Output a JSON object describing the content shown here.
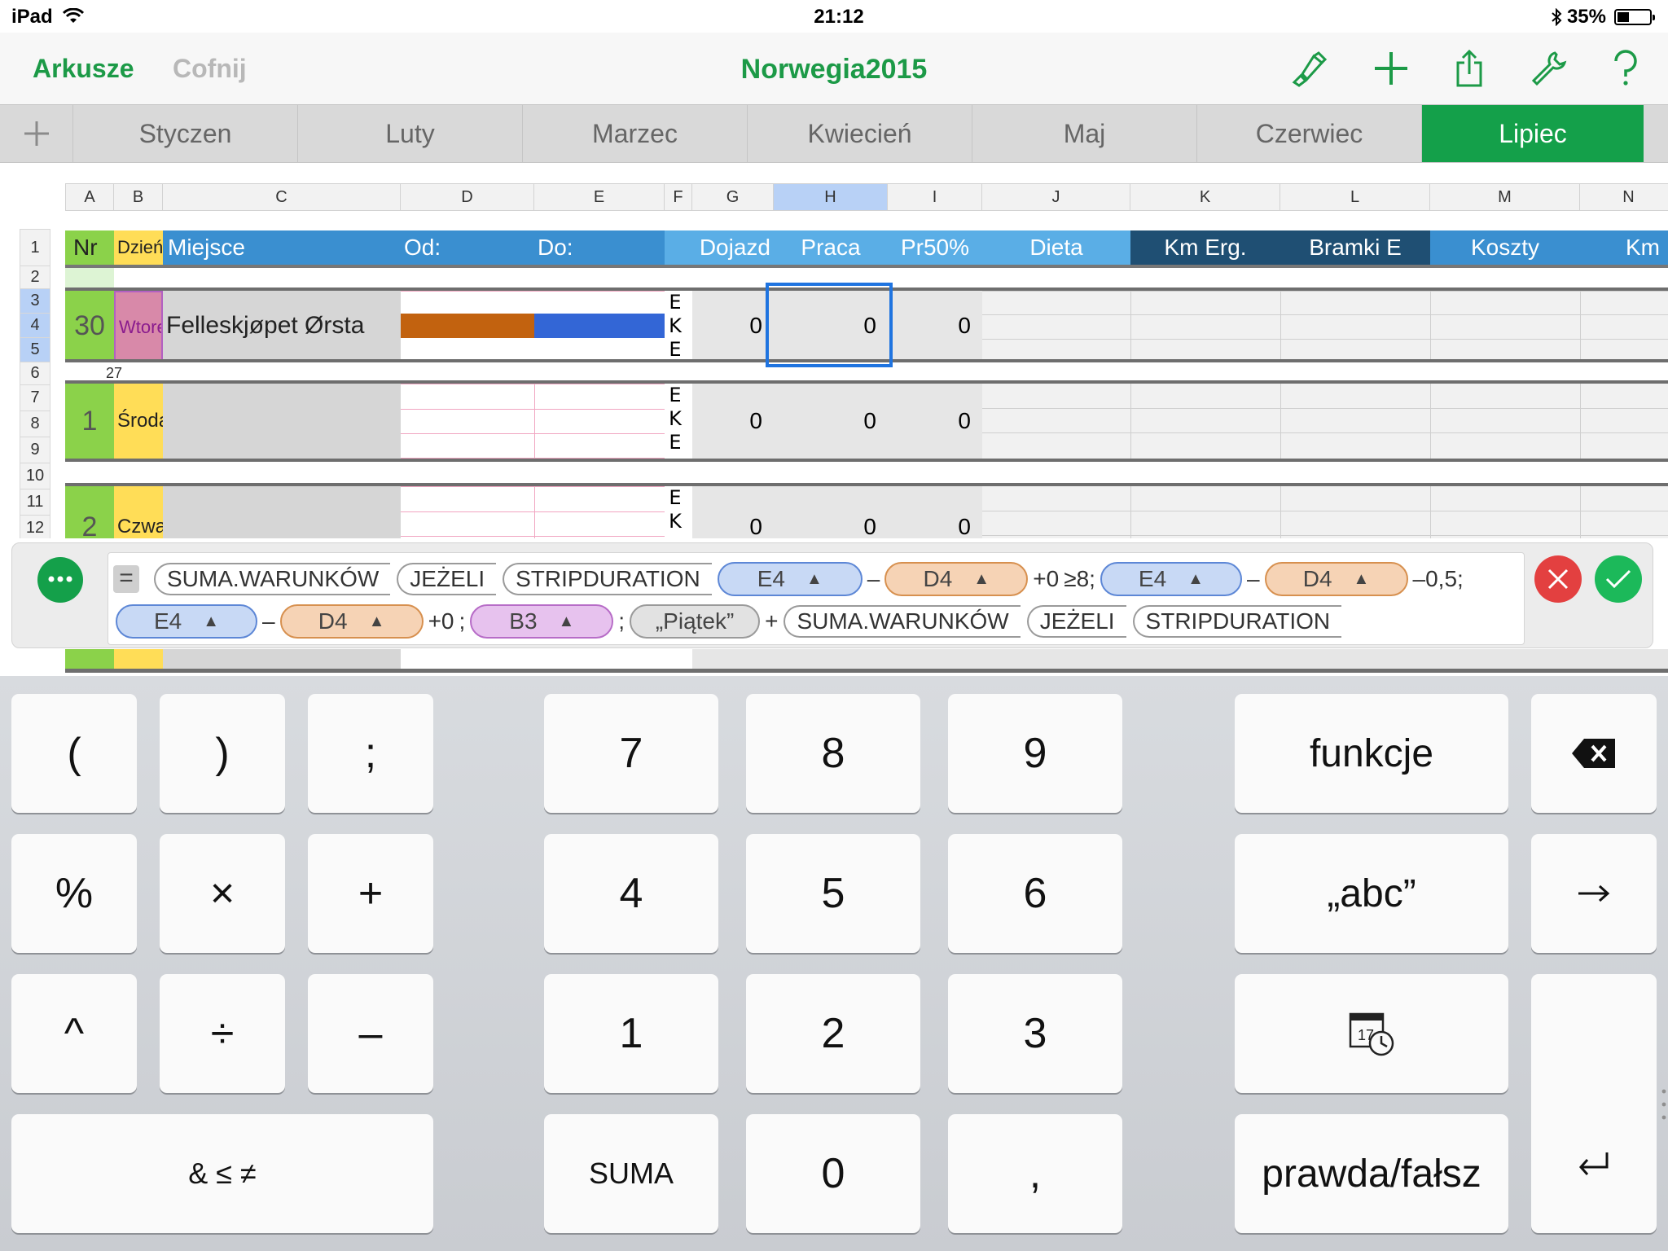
{
  "status_bar": {
    "device": "iPad",
    "time": "21:12",
    "battery": "35%",
    "battery_level": 0.35
  },
  "nav": {
    "back_label": "Arkusze",
    "undo_label": "Cofnij",
    "title": "Norwegia2015"
  },
  "tabs": [
    "Styczen",
    "Luty",
    "Marzec",
    "Kwiecień",
    "Maj",
    "Czerwiec",
    "Lipiec"
  ],
  "active_tab": "Lipiec",
  "columns": [
    "A",
    "B",
    "C",
    "D",
    "E",
    "F",
    "G",
    "H",
    "I",
    "J",
    "K",
    "L",
    "M",
    "N"
  ],
  "selected_column": "H",
  "rows": [
    "1",
    "2",
    "3",
    "4",
    "5",
    "6",
    "7",
    "8",
    "9",
    "10",
    "11",
    "12"
  ],
  "table": {
    "headers": {
      "nr": "Nr",
      "dzien": "Dzień",
      "miejsce": "Miejsce",
      "od": "Od:",
      "do": "Do:",
      "dojazd": "Dojazd",
      "praca": "Praca",
      "pr50": "Pr50%",
      "dieta": "Dieta",
      "km_erg": "Km Erg.",
      "bramki": "Bramki E",
      "koszty": "Koszty",
      "km": "Km"
    },
    "entries": [
      {
        "nr": "30",
        "dzien": "Wtorek",
        "miejsce": "Felleskjøpet Ørsta",
        "below": "27",
        "ekl": [
          "E",
          "K",
          "E"
        ],
        "dojazd": "0",
        "praca": "0",
        "pr50": "0"
      },
      {
        "nr": "1",
        "dzien": "Środa",
        "miejsce": "",
        "ekl": [
          "E",
          "K",
          "E"
        ],
        "dojazd": "0",
        "praca": "0",
        "pr50": "0"
      },
      {
        "nr": "2",
        "dzien": "Czwartek",
        "miejsce": "",
        "ekl": [
          "E",
          "K"
        ],
        "dojazd": "0",
        "praca": "0",
        "pr50": "0"
      }
    ]
  },
  "formula": {
    "equals": "=",
    "line1": {
      "fn1": "SUMA.WARUNKÓW",
      "fn2": "JEŻELI",
      "fn3": "STRIPDURATION",
      "r1": "E4",
      "minus1": "–",
      "r2": "D4",
      "plus0a": "+0",
      "cmp": "≥8;",
      "r3": "E4",
      "minus2": "–",
      "r4": "D4",
      "tail": "–0,5;"
    },
    "line2": {
      "r5": "E4",
      "minus3": "–",
      "r6": "D4",
      "plus0b": "+0",
      "semi1": ";",
      "r7": "B3",
      "semi2": ";",
      "str": "„Piątek”",
      "plus": "+",
      "fn4": "SUMA.WARUNKÓW",
      "fn5": "JEŻELI",
      "fn6": "STRIPDURATION"
    },
    "triangle": "▲"
  },
  "keyboard": {
    "open_paren": "(",
    "close_paren": ")",
    "semicolon": ";",
    "percent": "%",
    "multiply": "×",
    "plus": "+",
    "power": "^",
    "divide": "÷",
    "minus": "–",
    "comparators": "& ≤ ≠",
    "d7": "7",
    "d8": "8",
    "d9": "9",
    "d4": "4",
    "d5": "5",
    "d6": "6",
    "d1": "1",
    "d2": "2",
    "d3": "3",
    "suma": "SUMA",
    "d0": "0",
    "comma": ",",
    "functions": "funkcje",
    "string": "„abc”",
    "boolean": "prawda/fałsz",
    "calendar_day": "17"
  },
  "colors": {
    "accent": "#14a04a",
    "header_blue": "#3a8fd0",
    "header_light_blue": "#5aaee6",
    "header_dark": "#1f4f73",
    "nr_green": "#8bd24a",
    "day_yellow": "#ffdd57",
    "day_pink": "#d889a9",
    "bar_orange": "#c2620f",
    "bar_blue": "#3366d6"
  }
}
